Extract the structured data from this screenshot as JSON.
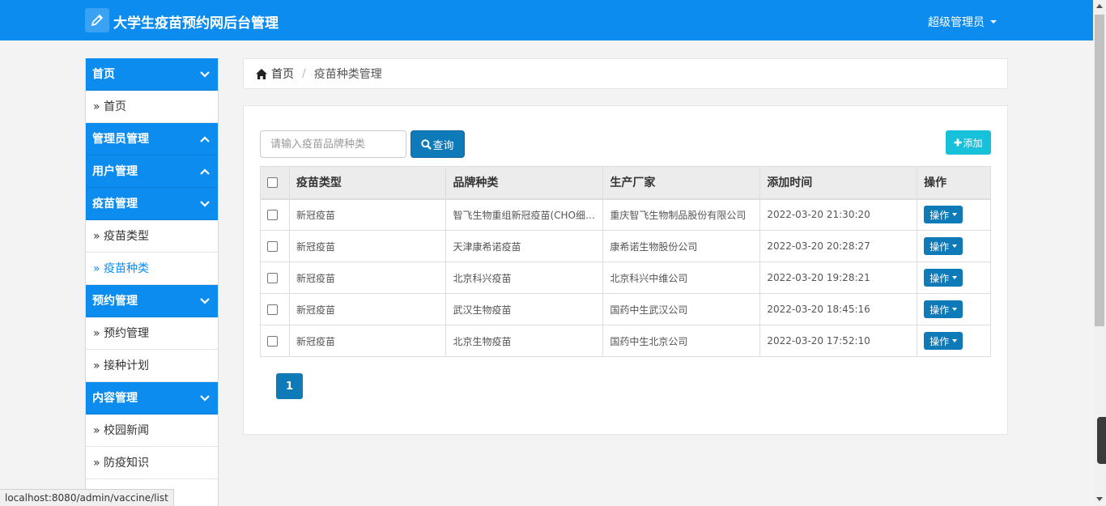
{
  "header": {
    "title": "大学生疫苗预约网后台管理",
    "user": "超级管理员",
    "brand_color": "#0d8cf0"
  },
  "sidebar": {
    "sections": [
      {
        "title": "首页",
        "expanded": true,
        "items": [
          {
            "label": "» 首页",
            "active": false
          }
        ]
      },
      {
        "title": "管理员管理",
        "expanded": false,
        "items": []
      },
      {
        "title": "用户管理",
        "expanded": false,
        "items": []
      },
      {
        "title": "疫苗管理",
        "expanded": true,
        "items": [
          {
            "label": "» 疫苗类型",
            "active": false
          },
          {
            "label": "» 疫苗种类",
            "active": true
          }
        ]
      },
      {
        "title": "预约管理",
        "expanded": true,
        "items": [
          {
            "label": "» 预约管理",
            "active": false
          },
          {
            "label": "» 接种计划",
            "active": false
          }
        ]
      },
      {
        "title": "内容管理",
        "expanded": true,
        "items": [
          {
            "label": "» 校园新闻",
            "active": false
          },
          {
            "label": "» 防疫知识",
            "active": false
          }
        ]
      }
    ]
  },
  "breadcrumb": {
    "home": "首页",
    "separator": "/",
    "current": "疫苗种类管理"
  },
  "search": {
    "placeholder": "请输入疫苗品牌种类",
    "value": "",
    "button_label": "查询"
  },
  "toolbar": {
    "add_label": "添加"
  },
  "table": {
    "columns": [
      "疫苗类型",
      "品牌种类",
      "生产厂家",
      "添加时间",
      "操作"
    ],
    "action_label": "操作",
    "rows": [
      {
        "type": "新冠疫苗",
        "brand": "智飞生物重组新冠疫苗(CHO细…",
        "maker": "重庆智飞生物制品股份有限公司",
        "time": "2022-03-20 21:30:20"
      },
      {
        "type": "新冠疫苗",
        "brand": "天津康希诺疫苗",
        "maker": "康希诺生物股份公司",
        "time": "2022-03-20 20:28:27"
      },
      {
        "type": "新冠疫苗",
        "brand": "北京科兴疫苗",
        "maker": "北京科兴中维公司",
        "time": "2022-03-20 19:28:21"
      },
      {
        "type": "新冠疫苗",
        "brand": "武汉生物疫苗",
        "maker": "国药中生武汉公司",
        "time": "2022-03-20 18:45:16"
      },
      {
        "type": "新冠疫苗",
        "brand": "北京生物疫苗",
        "maker": "国药中生北京公司",
        "time": "2022-03-20 17:52:10"
      }
    ]
  },
  "pagination": {
    "current_page": "1"
  },
  "status_bar": {
    "url": "localhost:8080/admin/vaccine/list"
  }
}
